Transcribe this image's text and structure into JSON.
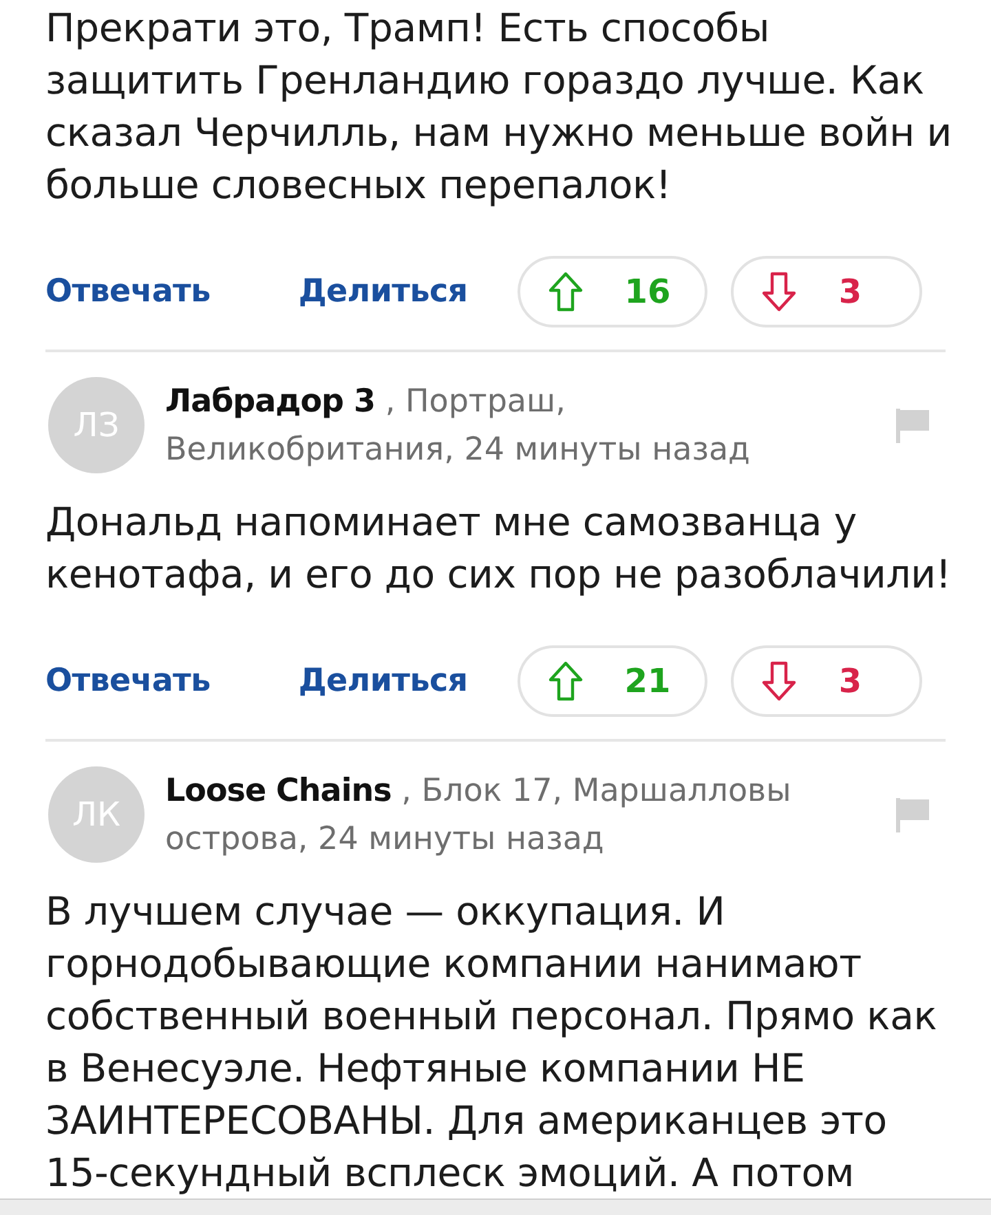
{
  "comments": [
    {
      "body": "Прекрати это, Трамп! Есть способы защитить Гренландию гораздо лучше. Как сказал Черчилль, нам нужно меньше войн и больше словесных перепалок!",
      "reply": "Отвечать",
      "share": "Делиться",
      "upvotes": "16",
      "downvotes": "3"
    },
    {
      "avatar": "ЛЗ",
      "author": "Лабрадор 3",
      "meta": ", Портраш, Великобритания, 24 минуты назад",
      "body": "Дональд напоминает мне самозванца у кенотафа, и его до сих пор не разоблачили!",
      "reply": "Отвечать",
      "share": "Делиться",
      "upvotes": "21",
      "downvotes": "3"
    },
    {
      "avatar": "ЛК",
      "author": "Loose Chains",
      "meta": ", Блок 17, Маршалловы острова, 24 минуты назад",
      "body": "В лучшем случае — оккупация. И горнодобывающие компании нанимают собственный военный персонал. Прямо как в Венесуэле. Нефтяные компании НЕ ЗАИНТЕРЕСОВАНЫ. Для американцев это 15-секундный всплеск эмоций. А потом"
    }
  ]
}
